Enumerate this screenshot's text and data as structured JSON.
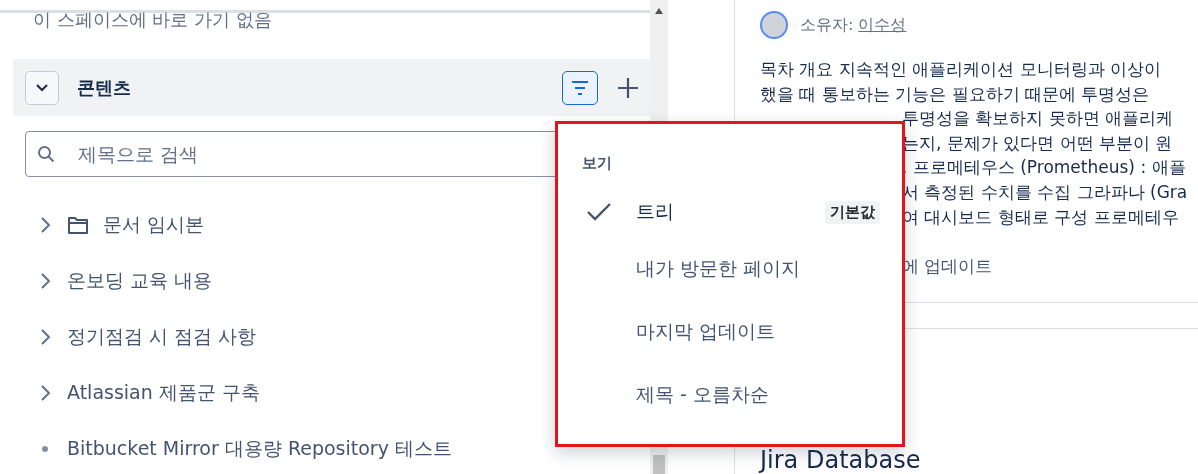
{
  "sidebar": {
    "shortcut_note": "이 스페이스에 바로 가기 없음",
    "section": {
      "title": "콘텐츠",
      "expanded": true
    },
    "search": {
      "placeholder": "제목으로 검색"
    },
    "items": [
      {
        "title": "문서 임시본",
        "kind": "folder",
        "has_children": true
      },
      {
        "title": "온보딩 교육 내용",
        "kind": "page",
        "has_children": true
      },
      {
        "title": "정기점검 시 점검 사항",
        "kind": "page",
        "has_children": true
      },
      {
        "title": "Atlassian 제품군 구축",
        "kind": "page",
        "has_children": true
      },
      {
        "title": "Bitbucket Mirror 대용량 Repository 테스트",
        "kind": "page",
        "has_children": false
      }
    ]
  },
  "view_menu": {
    "heading": "보기",
    "options": [
      {
        "label": "트리",
        "selected": true,
        "badge": "기본값"
      },
      {
        "label": "내가 방문한 페이지",
        "selected": false
      },
      {
        "label": "마지막 업데이트",
        "selected": false
      },
      {
        "label": "제목 - 오름차순",
        "selected": false
      }
    ]
  },
  "page": {
    "owner_label": "소유자:",
    "owner_name": "이수성",
    "body_lines": [
      "목차 개요 지속적인 애플리케이션 모니터링과 이상이",
      "했을 때 통보하는 기능은 필요하기 때문에 투명성은",
      "투명성을 확보하지 못하면 애플리케",
      "는지, 문제가 있다면 어떤 부분이 원",
      ". 프로메테우스 (Prometheus) : 애플",
      "서 측정된 수치를 수집 그라파나 (Gra",
      "여 대시보드 형태로 구성 프로메테우"
    ],
    "updated": "에 업데이트",
    "heading": "Jira Database"
  }
}
